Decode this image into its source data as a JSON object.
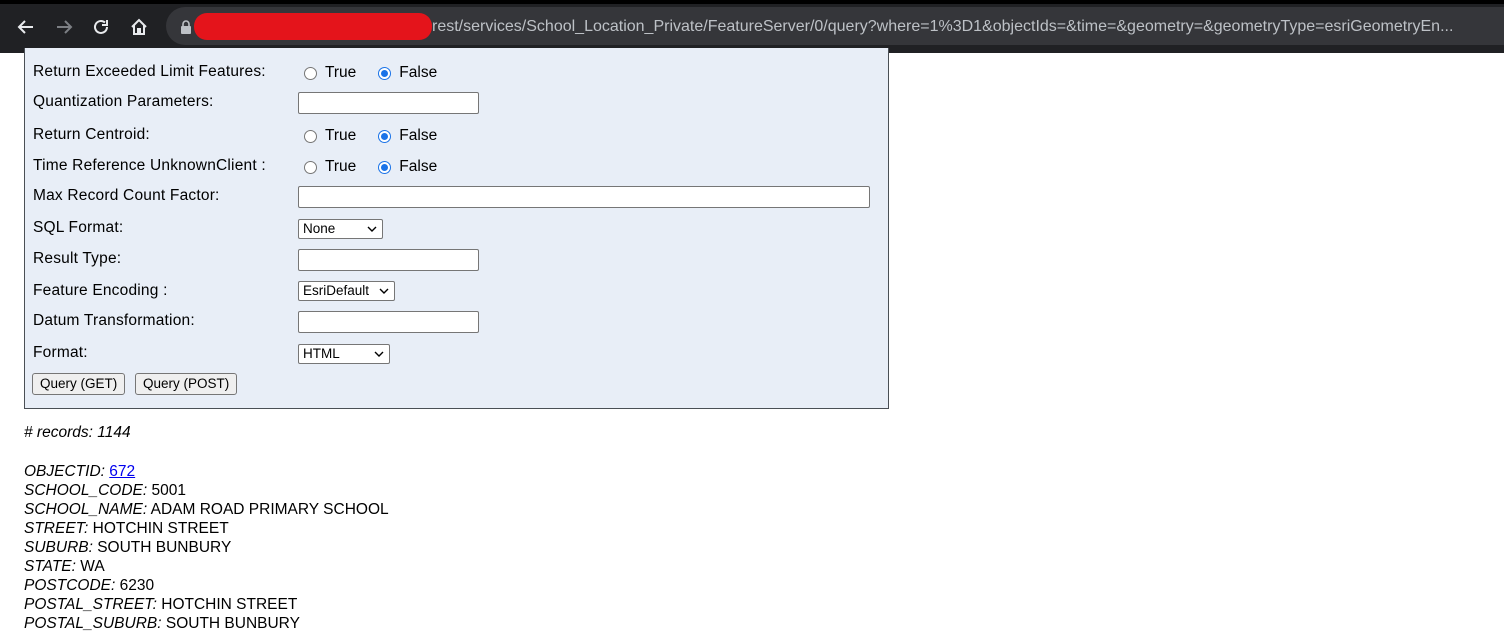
{
  "browser": {
    "url": "rest/services/School_Location_Private/FeatureServer/0/query?where=1%3D1&objectIds=&time=&geometry=&geometryType=esriGeometryEn..."
  },
  "form": {
    "rows": [
      {
        "label": "Return Exceeded Limit Features:",
        "type": "radio",
        "options": [
          "True",
          "False"
        ],
        "selected": "False"
      },
      {
        "label": "Quantization Parameters:",
        "type": "text",
        "value": ""
      },
      {
        "label": "Return Centroid:",
        "type": "radio",
        "options": [
          "True",
          "False"
        ],
        "selected": "False"
      },
      {
        "label": "Time Reference UnknownClient :",
        "type": "radio",
        "options": [
          "True",
          "False"
        ],
        "selected": "False"
      },
      {
        "label": "Max Record Count Factor:",
        "type": "text",
        "value": ""
      },
      {
        "label": "SQL Format:",
        "type": "select",
        "value": "None"
      },
      {
        "label": "Result Type:",
        "type": "text",
        "value": ""
      },
      {
        "label": "Feature Encoding :",
        "type": "select",
        "value": "EsriDefault"
      },
      {
        "label": "Datum Transformation:",
        "type": "text",
        "value": ""
      },
      {
        "label": "Format:",
        "type": "select",
        "value": "HTML"
      }
    ],
    "buttons": {
      "query_get": "Query (GET)",
      "query_post": "Query (POST)"
    }
  },
  "results": {
    "records_label": "# records:",
    "records_count": "1144",
    "fields": [
      {
        "key": "OBJECTID:",
        "value": "672",
        "link": true
      },
      {
        "key": "SCHOOL_CODE:",
        "value": "5001"
      },
      {
        "key": "SCHOOL_NAME:",
        "value": "ADAM ROAD PRIMARY SCHOOL"
      },
      {
        "key": "STREET:",
        "value": "HOTCHIN STREET"
      },
      {
        "key": "SUBURB:",
        "value": "SOUTH BUNBURY"
      },
      {
        "key": "STATE:",
        "value": "WA"
      },
      {
        "key": "POSTCODE:",
        "value": "6230"
      },
      {
        "key": "POSTAL_STREET:",
        "value": "HOTCHIN STREET"
      },
      {
        "key": "POSTAL_SUBURB:",
        "value": "SOUTH BUNBURY"
      }
    ]
  }
}
